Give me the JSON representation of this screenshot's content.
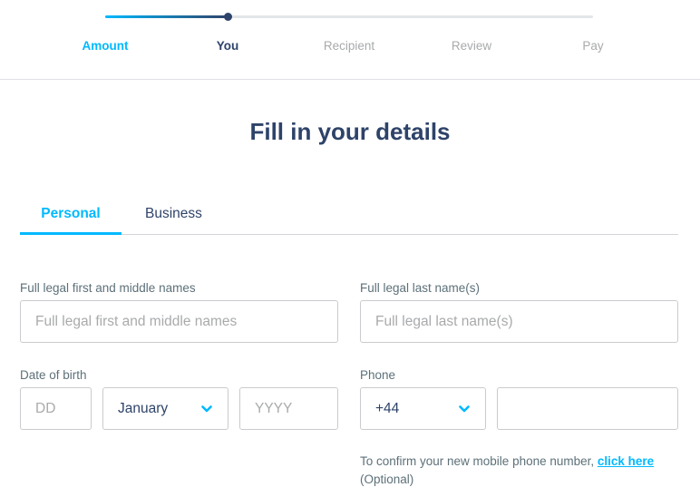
{
  "stepper": {
    "progress_percent": 25,
    "steps": [
      {
        "label": "Amount",
        "state": "done"
      },
      {
        "label": "You",
        "state": "active"
      },
      {
        "label": "Recipient",
        "state": "upcoming"
      },
      {
        "label": "Review",
        "state": "upcoming"
      },
      {
        "label": "Pay",
        "state": "upcoming"
      }
    ]
  },
  "page": {
    "title": "Fill in your details"
  },
  "tabs": [
    {
      "label": "Personal",
      "active": true
    },
    {
      "label": "Business",
      "active": false
    }
  ],
  "form": {
    "first_names": {
      "label": "Full legal first and middle names",
      "placeholder": "Full legal first and middle names",
      "value": ""
    },
    "last_names": {
      "label": "Full legal last name(s)",
      "placeholder": "Full legal last name(s)",
      "value": ""
    },
    "dob": {
      "label": "Date of birth",
      "day_placeholder": "DD",
      "month_value": "January",
      "year_placeholder": "YYYY"
    },
    "phone": {
      "label": "Phone",
      "country_code": "+44",
      "number_value": ""
    },
    "helper": {
      "text": "To confirm your new mobile phone number, ",
      "link": "click here ",
      "suffix": "(Optional)"
    }
  },
  "colors": {
    "accent": "#00b9ff",
    "navy": "#2e4369",
    "muted": "#a8aaac",
    "border": "#c9cbce"
  }
}
